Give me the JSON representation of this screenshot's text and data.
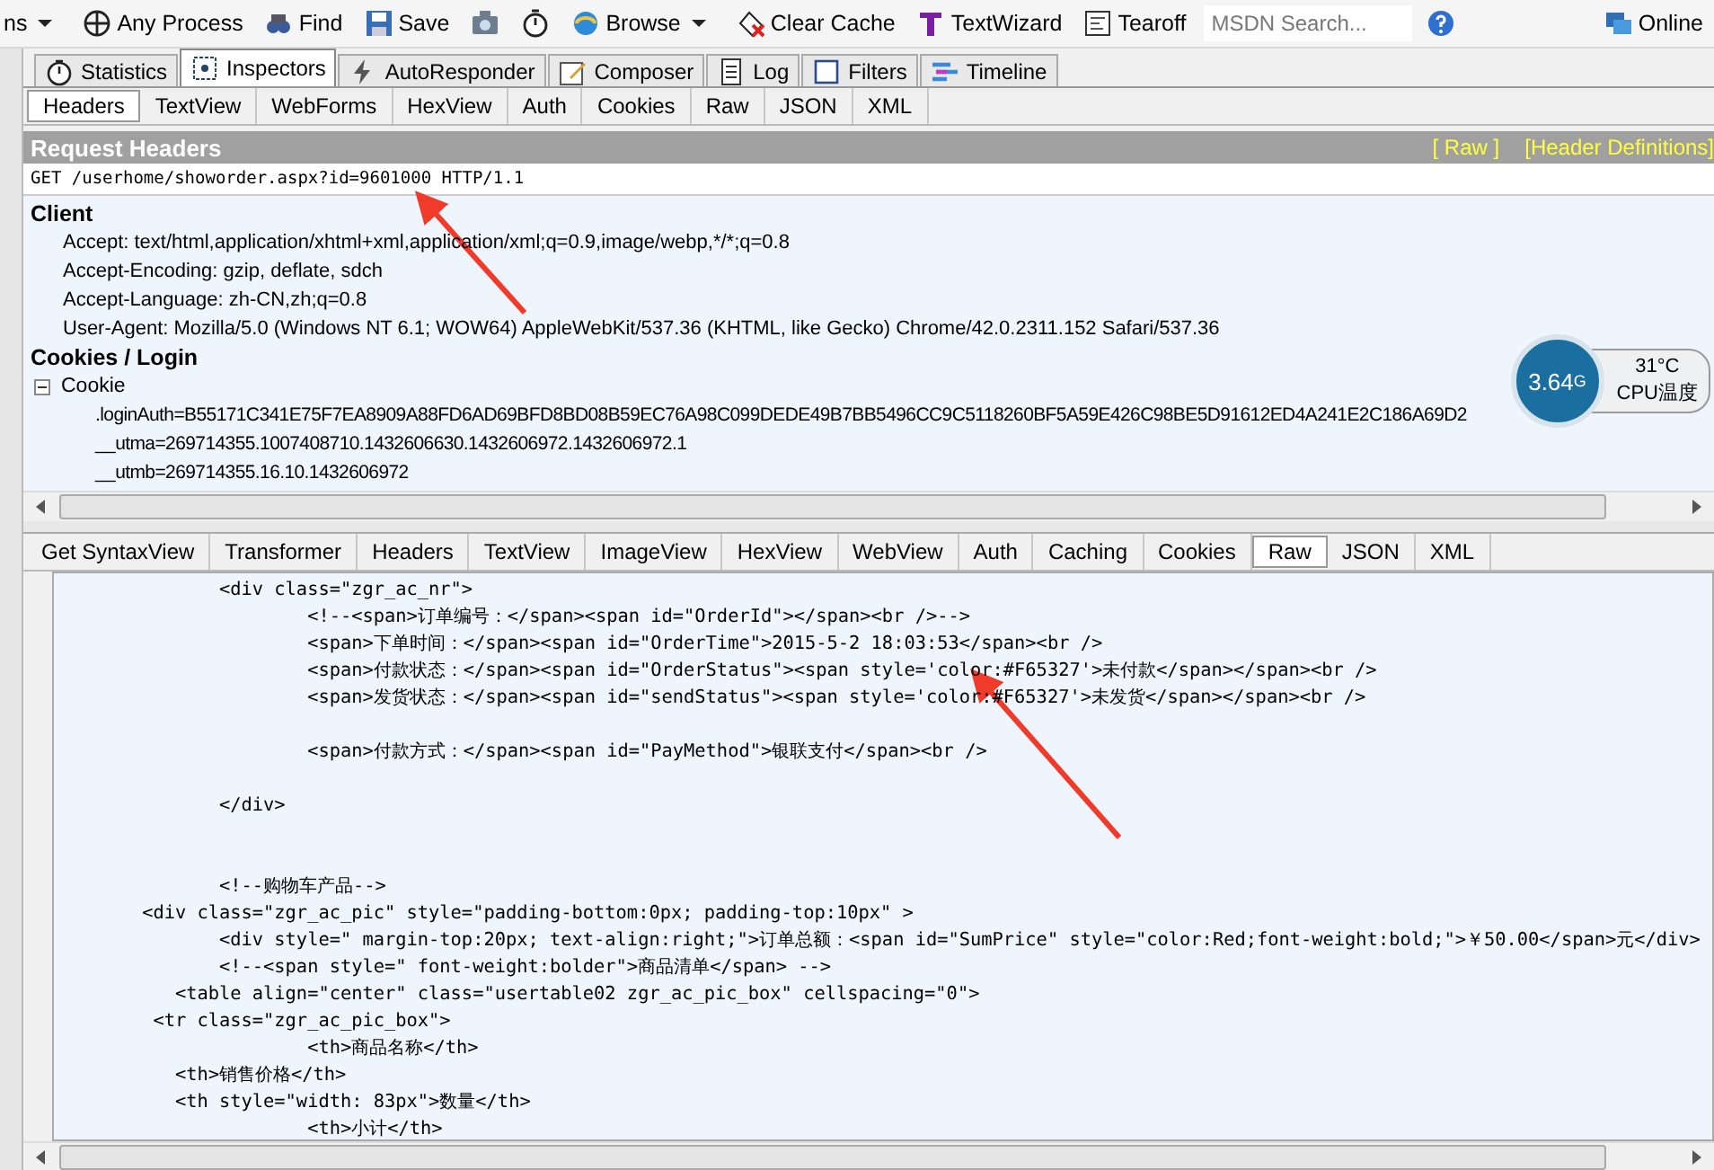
{
  "toolbar": {
    "items": [
      {
        "label": "ns",
        "kind": "menu"
      },
      {
        "label": "Any Process",
        "kind": "target"
      },
      {
        "label": "Find",
        "kind": "find"
      },
      {
        "label": "Save",
        "kind": "save"
      },
      {
        "kind": "camera"
      },
      {
        "kind": "timer"
      },
      {
        "label": "Browse",
        "kind": "browse"
      },
      {
        "label": "Clear Cache",
        "kind": "clear"
      },
      {
        "label": "TextWizard",
        "kind": "wizard"
      },
      {
        "label": "Tearoff",
        "kind": "tearoff"
      }
    ],
    "search": {
      "placeholder": "MSDN Search..."
    },
    "online": "Online"
  },
  "main_tabs": [
    {
      "label": "Statistics",
      "selected": false
    },
    {
      "label": "Inspectors",
      "selected": true
    },
    {
      "label": "AutoResponder",
      "selected": false
    },
    {
      "label": "Composer",
      "selected": false
    },
    {
      "label": "Log",
      "selected": false
    },
    {
      "label": "Filters",
      "selected": false
    },
    {
      "label": "Timeline",
      "selected": false
    }
  ],
  "request_tabs": [
    {
      "label": "Headers",
      "selected": true
    },
    {
      "label": "TextView",
      "selected": false
    },
    {
      "label": "WebForms",
      "selected": false
    },
    {
      "label": "HexView",
      "selected": false
    },
    {
      "label": "Auth",
      "selected": false
    },
    {
      "label": "Cookies",
      "selected": false
    },
    {
      "label": "Raw",
      "selected": false
    },
    {
      "label": "JSON",
      "selected": false
    },
    {
      "label": "XML",
      "selected": false
    }
  ],
  "request_headers": {
    "title": "Request Headers",
    "links": [
      "[ Raw ]",
      "[Header Definitions]"
    ],
    "request_line": "GET /userhome/showorder.aspx?id=9601000 HTTP/1.1",
    "groups": [
      {
        "title": "Client",
        "items": [
          {
            "text": "Accept: text/html,application/xhtml+xml,application/xml;q=0.9,image/webp,*/*;q=0.8"
          },
          {
            "text": "Accept-Encoding: gzip, deflate, sdch"
          },
          {
            "text": "Accept-Language: zh-CN,zh;q=0.8"
          },
          {
            "text": "User-Agent: Mozilla/5.0 (Windows NT 6.1; WOW64) AppleWebKit/537.36 (KHTML, like Gecko) Chrome/42.0.2311.152 Safari/537.36"
          }
        ]
      },
      {
        "title": "Cookies / Login",
        "items": [
          {
            "text": "Cookie",
            "expanded": true,
            "children": [
              {
                "text": ".loginAuth=B55171C341E75F7EA8909A88FD6AD69BFD8BD08B59EC76A98C099DEDE49B7BB5496CC9C5118260BF5A59E426C98BE5D91612ED4A241E2C186A69D2"
              },
              {
                "text": "__utma=269714355.1007408710.1432606630.1432606972.1432606972.1"
              },
              {
                "text": "__utmb=269714355.16.10.1432606972"
              }
            ]
          }
        ]
      }
    ]
  },
  "cpu_widget": {
    "value": "3.64",
    "unit": "G",
    "temperature": "31°C",
    "label": "CPU温度"
  },
  "response_tabs": [
    {
      "label": "Get SyntaxView",
      "selected": false
    },
    {
      "label": "Transformer",
      "selected": false
    },
    {
      "label": "Headers",
      "selected": false
    },
    {
      "label": "TextView",
      "selected": false
    },
    {
      "label": "ImageView",
      "selected": false
    },
    {
      "label": "HexView",
      "selected": false
    },
    {
      "label": "WebView",
      "selected": false
    },
    {
      "label": "Auth",
      "selected": false
    },
    {
      "label": "Caching",
      "selected": false
    },
    {
      "label": "Cookies",
      "selected": false
    },
    {
      "label": "Raw",
      "selected": true
    },
    {
      "label": "JSON",
      "selected": false
    },
    {
      "label": "XML",
      "selected": false
    }
  ],
  "code_lines": [
    {
      "kind": "code",
      "text": "               <div class=\"zgr_ac_nr\">"
    },
    {
      "kind": "code",
      "text": "                       <!--<span>订单编号：</span><span id=\"OrderId\"></span><br />-->"
    },
    {
      "kind": "code",
      "text": "                       <span>下单时间：</span><span id=\"OrderTime\">2015-5-2 18:03:53</span><br />"
    },
    {
      "kind": "code",
      "text": "                       <span>付款状态：</span><span id=\"OrderStatus\"><span style='color:#F65327'>未付款</span></span><br />"
    },
    {
      "kind": "code",
      "text": "                       <span>发货状态：</span><span id=\"sendStatus\"><span style='color:#F65327'>未发货</span></span><br />"
    },
    {
      "kind": "blank"
    },
    {
      "kind": "code",
      "text": "                       <span>付款方式：</span><span id=\"PayMethod\">银联支付</span><br />"
    },
    {
      "kind": "blank"
    },
    {
      "kind": "code",
      "text": "               </div>"
    },
    {
      "kind": "blank"
    },
    {
      "kind": "blank"
    },
    {
      "kind": "code",
      "text": "               <!--购物车产品-->"
    },
    {
      "kind": "code",
      "text": "        <div class=\"zgr_ac_pic\" style=\"padding-bottom:0px; padding-top:10px\" >"
    },
    {
      "kind": "code",
      "text": "               <div style=\" margin-top:20px; text-align:right;\">订单总额：<span id=\"SumPrice\" style=\"color:Red;font-weight:bold;\">￥50.00</span>元</div>"
    },
    {
      "kind": "code",
      "text": "               <!--<span style=\" font-weight:bolder\">商品清单</span> -->"
    },
    {
      "kind": "code",
      "text": "           <table align=\"center\" class=\"usertable02 zgr_ac_pic_box\" cellspacing=\"0\">"
    },
    {
      "kind": "code",
      "text": "         <tr class=\"zgr_ac_pic_box\">"
    },
    {
      "kind": "code",
      "text": "                       <th>商品名称</th>"
    },
    {
      "kind": "code",
      "text": "           <th>销售价格</th>"
    },
    {
      "kind": "code",
      "text": "           <th style=\"width: 83px\">数量</th>"
    },
    {
      "kind": "code",
      "text": "                       <th>小计</th>"
    }
  ]
}
